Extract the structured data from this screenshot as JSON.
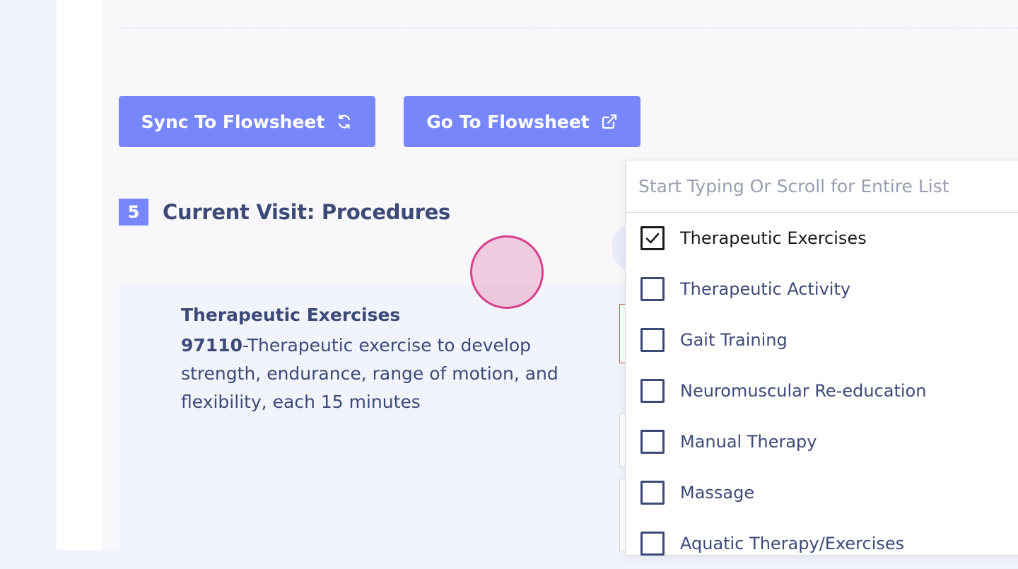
{
  "toolbar": {
    "sync_label": "Sync To Flowsheet",
    "sync_icon": "refresh-icon",
    "goto_label": "Go To Flowsheet",
    "goto_icon": "external-link-icon",
    "button_color": "#7787fb"
  },
  "section": {
    "step_number": "5",
    "title": "Current Visit: Procedures"
  },
  "procedure": {
    "name": "Therapeutic Exercises",
    "code": "97110",
    "description": "-Therapeutic exercise to develop strength, endurance, range of motion, and flexibility, each 15 minutes"
  },
  "dropdown": {
    "placeholder": "Start Typing Or Scroll for Entire List",
    "options": [
      {
        "label": "Therapeutic Exercises",
        "checked": true
      },
      {
        "label": "Therapeutic Activity",
        "checked": false
      },
      {
        "label": "Gait Training",
        "checked": false
      },
      {
        "label": "Neuromuscular Re-education",
        "checked": false
      },
      {
        "label": "Manual Therapy",
        "checked": false
      },
      {
        "label": "Massage",
        "checked": false
      },
      {
        "label": "Aquatic Therapy/Exercises",
        "checked": false
      }
    ]
  },
  "colors": {
    "primary": "#7787fb",
    "text": "#3d4a78",
    "cursor_highlight": "#d6418c"
  }
}
